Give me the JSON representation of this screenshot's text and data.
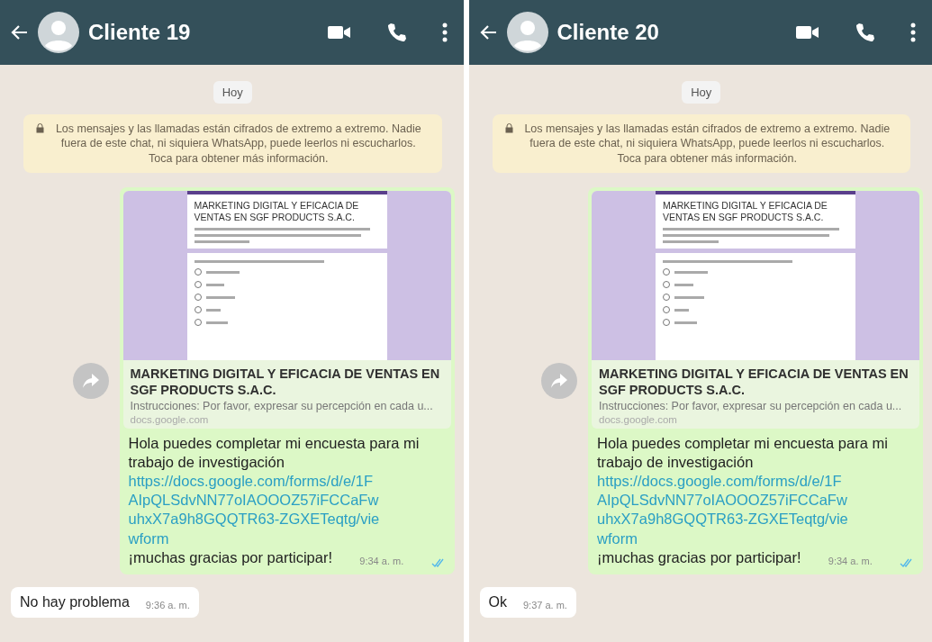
{
  "panels": [
    {
      "contact": "Cliente 19",
      "date": "Hoy",
      "notice": "Los mensajes y las llamadas están cifrados de extremo a extremo. Nadie fuera de este chat, ni siquiera WhatsApp, puede leerlos ni escucharlos. Toca para obtener más información.",
      "outgoing": {
        "preview_image_title": "MARKETING DIGITAL Y EFICACIA DE VENTAS EN SGF PRODUCTS S.A.C.",
        "link_title": "MARKETING DIGITAL Y EFICACIA DE VENTAS EN SGF PRODUCTS S.A.C.",
        "link_description": "Instrucciones: Por favor, expresar su percepción en cada u...",
        "link_domain": "docs.google.com",
        "text": "Hola puedes completar mi encuesta para mi trabajo de investigación",
        "url": "https://docs.google.com/forms/d/e/1FAIpQLSdvNN77oIAOOOZ57iFCCaFwuhxX7a9h8GQQTR63-ZGXETeqtg/viewform",
        "closing": "¡muchas gracias por participar!",
        "time": "9:34 a. m.",
        "read": true
      },
      "reply": {
        "text": "No hay problema",
        "time": "9:36 a. m."
      }
    },
    {
      "contact": "Cliente 20",
      "date": "Hoy",
      "notice": "Los mensajes y las llamadas están cifrados de extremo a extremo. Nadie fuera de este chat, ni siquiera WhatsApp, puede leerlos ni escucharlos. Toca para obtener más información.",
      "outgoing": {
        "preview_image_title": "MARKETING DIGITAL Y EFICACIA DE VENTAS EN SGF PRODUCTS S.A.C.",
        "link_title": "MARKETING DIGITAL Y EFICACIA DE VENTAS EN SGF PRODUCTS S.A.C.",
        "link_description": "Instrucciones: Por favor, expresar su percepción en cada u...",
        "link_domain": "docs.google.com",
        "text": "Hola puedes completar mi encuesta para mi trabajo de investigación",
        "url": "https://docs.google.com/forms/d/e/1FAIpQLSdvNN77oIAOOOZ57iFCCaFwuhxX7a9h8GQQTR63-ZGXETeqtg/viewform",
        "closing": "¡muchas gracias por participar!",
        "time": "9:34 a. m.",
        "read": true
      },
      "reply": {
        "text": "Ok",
        "time": "9:37 a. m."
      }
    }
  ]
}
